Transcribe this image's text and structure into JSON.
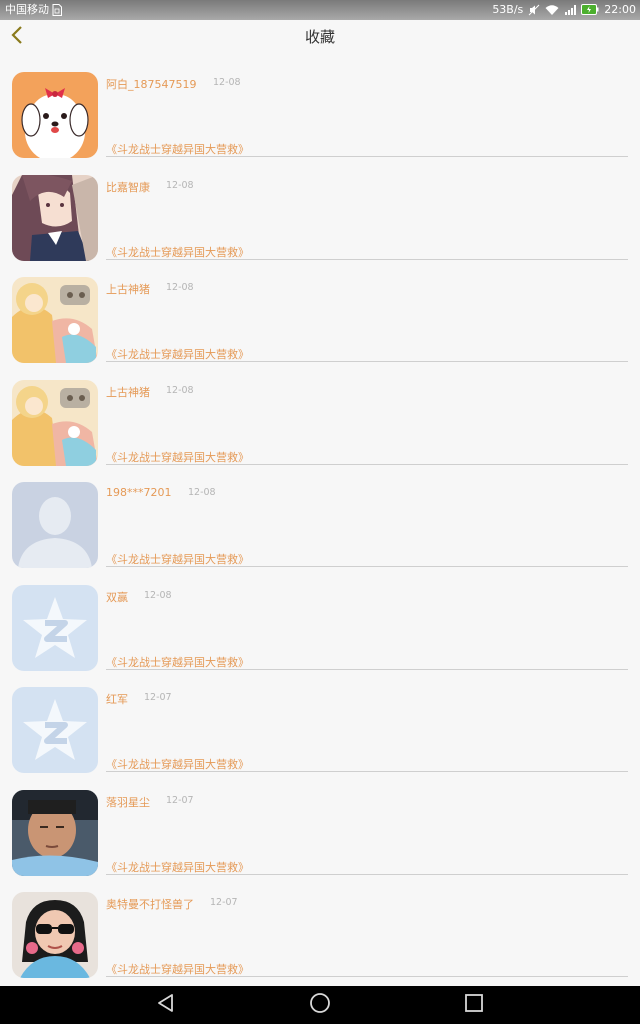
{
  "status_bar": {
    "carrier": "中国移动",
    "speed": "53B/s",
    "time": "22:00"
  },
  "header": {
    "title": "收藏"
  },
  "items": [
    {
      "name": "阿白_187547519",
      "date": "12-08",
      "title": "《斗龙战士穿越异国大营救》",
      "avatar": "cartoon-dog-avatar"
    },
    {
      "name": "比嘉智康",
      "date": "12-08",
      "title": "《斗龙战士穿越异国大营救》",
      "avatar": "anime-girl-avatar"
    },
    {
      "name": "上古神猪",
      "date": "12-08",
      "title": "《斗龙战士穿越异国大营救》",
      "avatar": "anime-illustration-avatar"
    },
    {
      "name": "上古神猪",
      "date": "12-08",
      "title": "《斗龙战士穿越异国大营救》",
      "avatar": "anime-illustration-avatar"
    },
    {
      "name": "198***7201",
      "date": "12-08",
      "title": "《斗龙战士穿越异国大营救》",
      "avatar": "default-person-avatar"
    },
    {
      "name": "双赢",
      "date": "12-08",
      "title": "《斗龙战士穿越异国大营救》",
      "avatar": "qq-star-avatar"
    },
    {
      "name": "红军",
      "date": "12-07",
      "title": "《斗龙战士穿越异国大营救》",
      "avatar": "qq-star-avatar"
    },
    {
      "name": "落羽星尘",
      "date": "12-07",
      "title": "《斗龙战士穿越异国大营救》",
      "avatar": "photo-boy-avatar"
    },
    {
      "name": "奥特曼不打怪兽了",
      "date": "12-07",
      "title": "《斗龙战士穿越异国大营救》",
      "avatar": "photo-girl-sunglasses-avatar"
    }
  ],
  "colors": {
    "accent": "#e59a57",
    "date": "#b5b5b5",
    "background": "#f7f7f7"
  },
  "nav_bar": {
    "back": "triangle-back-icon",
    "home": "circle-home-icon",
    "recents": "square-recents-icon"
  }
}
